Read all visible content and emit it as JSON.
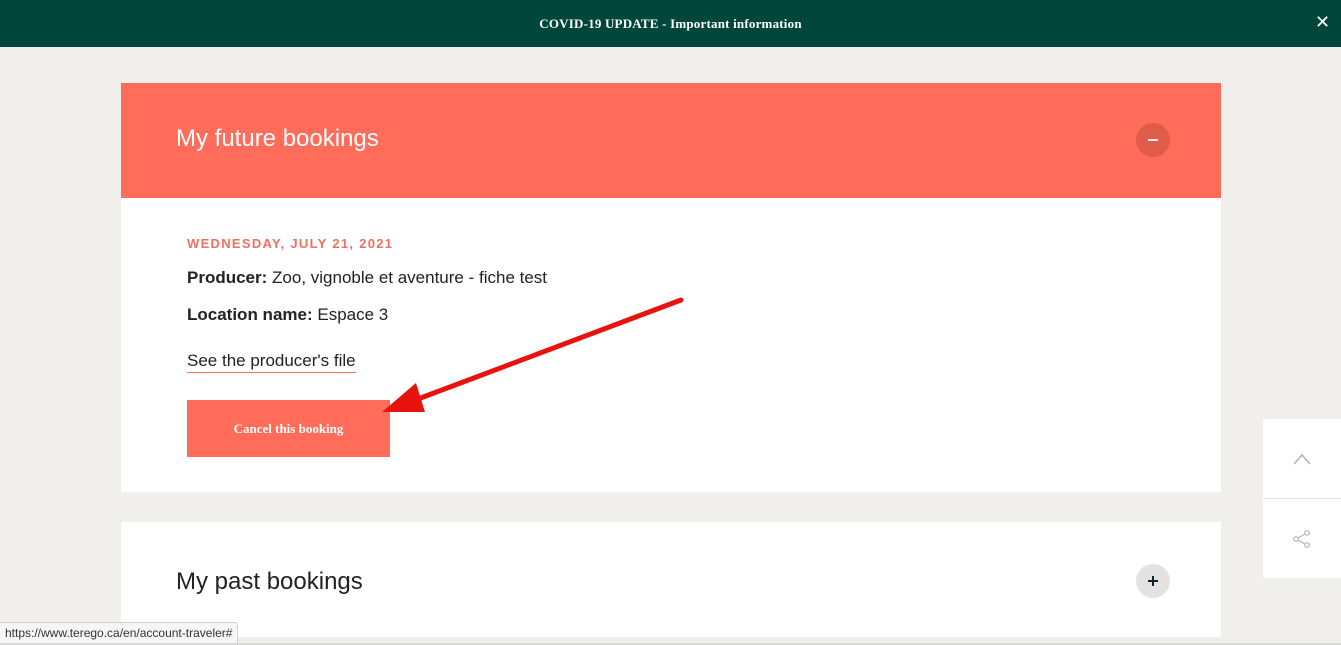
{
  "banner": {
    "text": "COVID-19 UPDATE - Important information",
    "close_glyph": "✕"
  },
  "future_bookings": {
    "title": "My future bookings",
    "toggle_icon": "minus-icon",
    "booking": {
      "date": "WEDNESDAY, JULY 21, 2021",
      "producer_label": "Producer:",
      "producer_value": "Zoo, vignoble et aventure - fiche test",
      "location_label": "Location name:",
      "location_value": "Espace 3",
      "producer_link": "See the producer's file",
      "cancel_label": "Cancel this booking"
    }
  },
  "past_bookings": {
    "title": "My past bookings",
    "toggle_icon": "plus-icon"
  },
  "side_tools": {
    "up_icon": "chevron-up-icon",
    "share_icon": "share-icon"
  },
  "status_bar": {
    "url": "https://www.terego.ca/en/account-traveler#"
  },
  "colors": {
    "banner_bg": "#00463a",
    "accent": "#ff6c5a",
    "page_bg": "#f1efeb",
    "annotation_arrow": "#e8130f"
  }
}
